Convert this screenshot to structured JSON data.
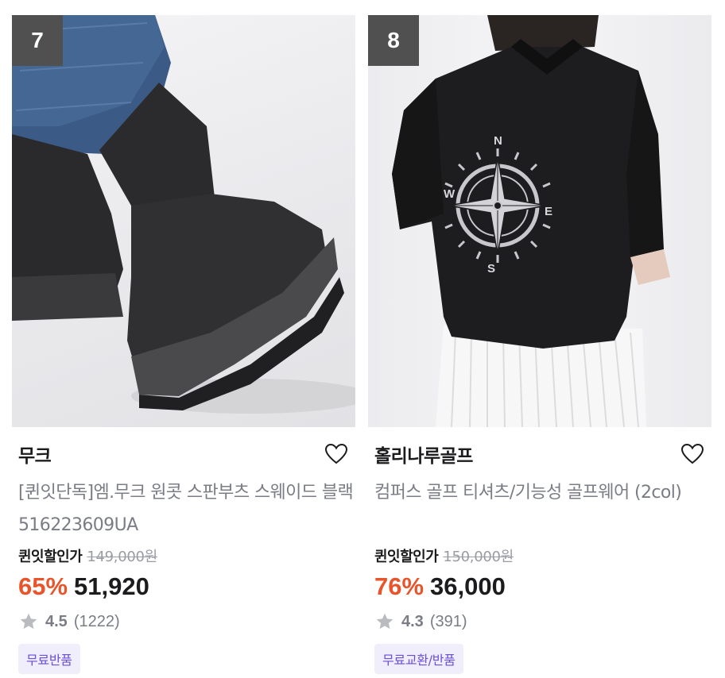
{
  "products": [
    {
      "rank": "7",
      "brand": "무크",
      "name": "[퀸잇단독]엠.무크 원콧 스판부츠 스웨이드 블랙 516223609UA",
      "sale_label": "퀸잇할인가",
      "original_price": "149,000원",
      "discount": "65%",
      "price": "51,920",
      "rating": "4.5",
      "reviews": "(1222)",
      "badge": "무료반품",
      "image_icon": "black-suede-sock-boots-photo"
    },
    {
      "rank": "8",
      "brand": "홀리나루골프",
      "name": "컴퍼스 골프 티셔츠/기능성 골프웨어 (2col)",
      "sale_label": "퀸잇할인가",
      "original_price": "150,000원",
      "discount": "76%",
      "price": "36,000",
      "rating": "4.3",
      "reviews": "(391)",
      "badge": "무료교환/반품",
      "image_icon": "black-compass-golf-tshirt-photo"
    }
  ],
  "icons": {
    "wishlist": "heart-outline-icon",
    "rating": "star-icon"
  },
  "colors": {
    "discount": "#e8542c",
    "badge_bg": "#f1eefc",
    "badge_text": "#6a4fd8",
    "rank_bg": "#505050"
  }
}
